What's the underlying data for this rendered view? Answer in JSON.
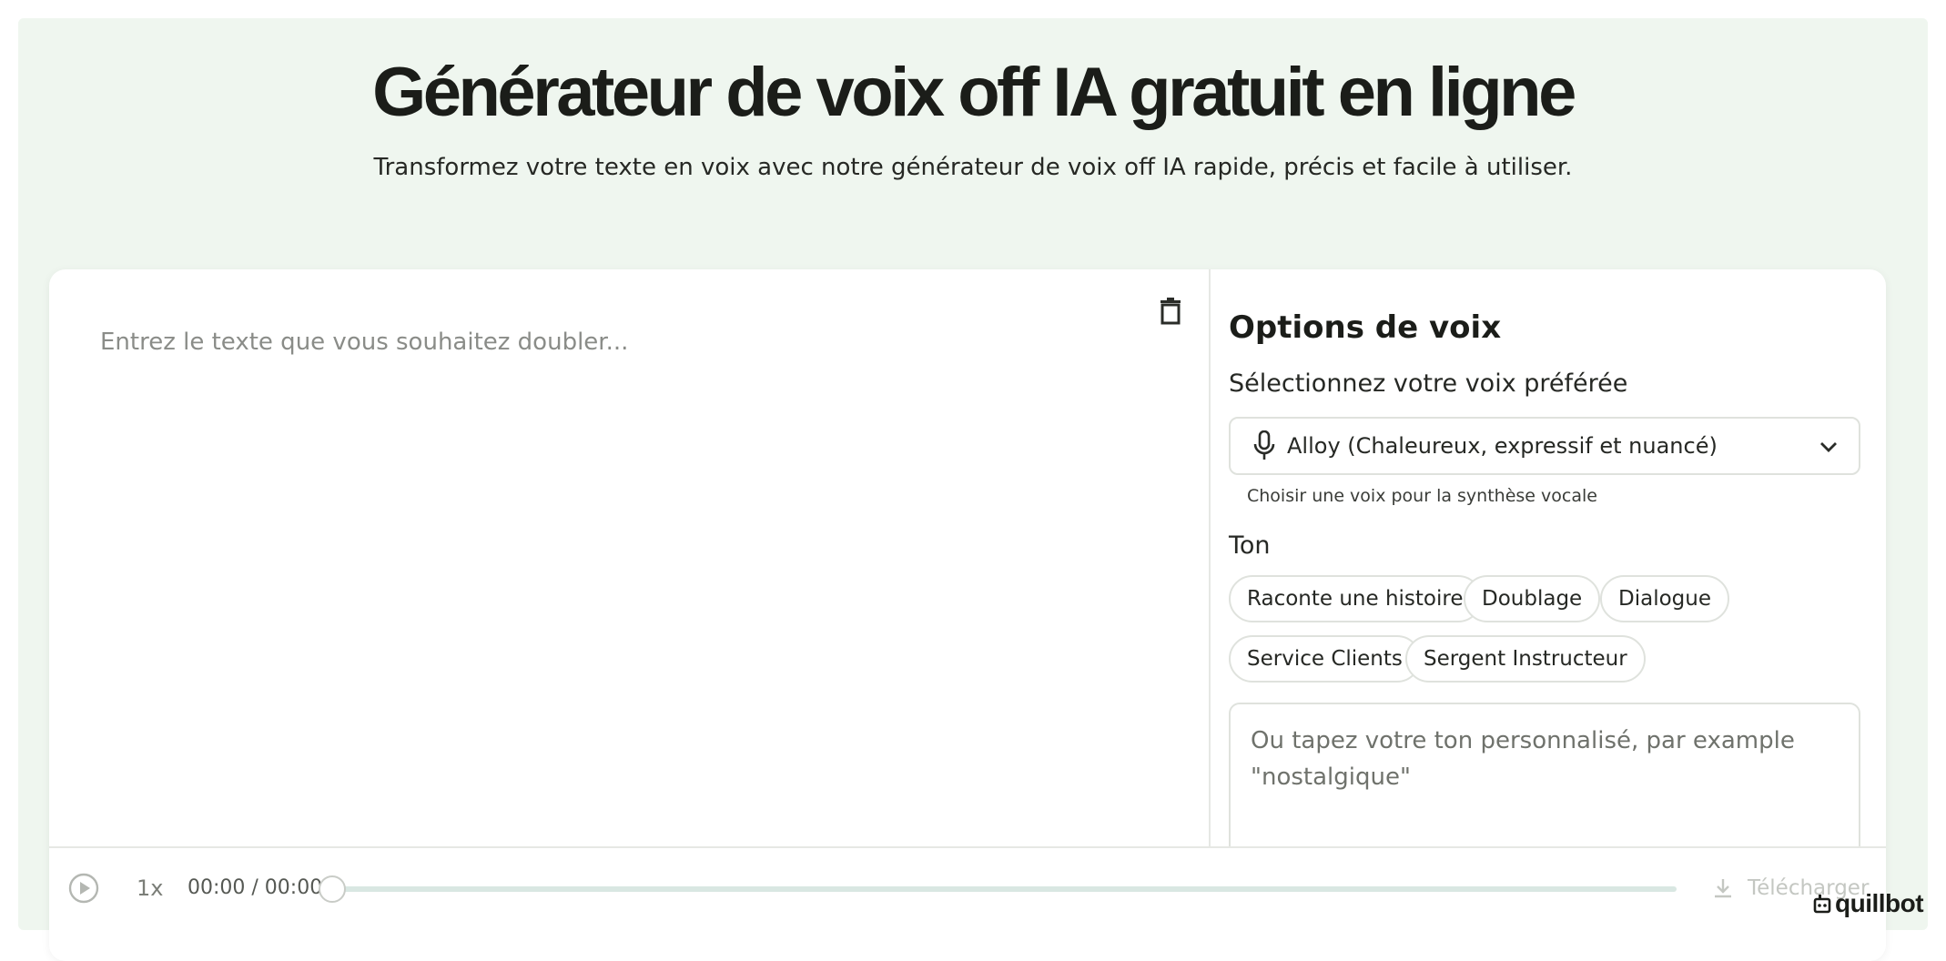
{
  "hero": {
    "title": "Générateur de voix off IA gratuit en ligne",
    "subtitle": "Transformez votre texte en voix avec notre générateur de voix off IA rapide, précis et facile à utiliser."
  },
  "editor": {
    "placeholder": "Entrez le texte que vous souhaitez doubler...",
    "value": "",
    "delete_icon": "trash-icon"
  },
  "voice_options": {
    "title": "Options de voix",
    "voice_label": "Sélectionnez votre voix préférée",
    "selected_voice": "Alloy (Chaleureux, expressif et nuancé)",
    "voice_helper": "Choisir une voix pour la synthèse vocale",
    "tone_label": "Ton",
    "tones": [
      {
        "label": "Raconte une histoire"
      },
      {
        "label": "Doublage"
      },
      {
        "label": "Dialogue"
      },
      {
        "label": "Service Clients"
      },
      {
        "label": "Sergent Instructeur"
      }
    ],
    "custom_tone_placeholder": "Ou tapez votre ton personnalisé, par example \"nostalgique\""
  },
  "player": {
    "speed": "1x",
    "time": "00:00 / 00:00",
    "progress": 0,
    "download_label": "Télécharger"
  },
  "brand": {
    "name": "quillbot"
  },
  "colors": {
    "hero_background": "#eff6ef",
    "progress_track": "#d9e7e2",
    "text_primary": "#1b1d19"
  }
}
